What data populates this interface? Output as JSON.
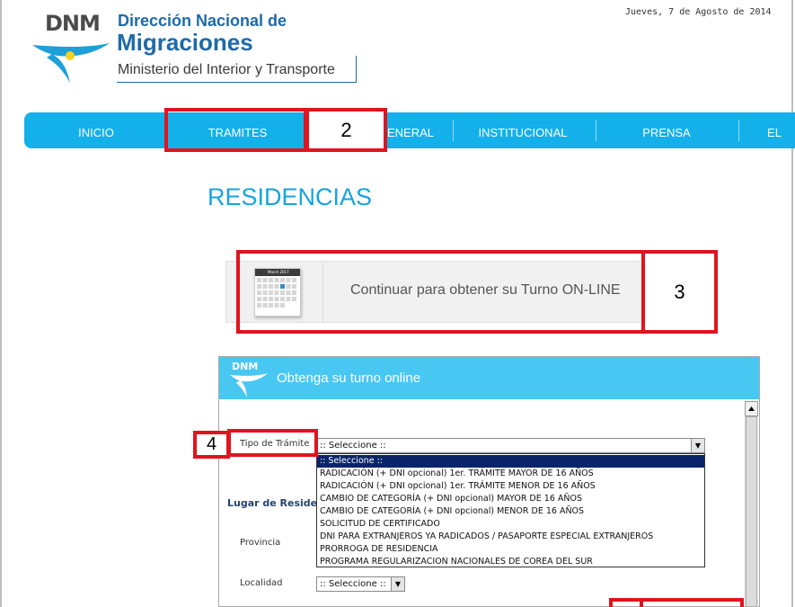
{
  "header": {
    "date": "Jueves, 7 de Agosto de 2014",
    "logo": {
      "acronym": "DNM",
      "line1": "Dirección Nacional de",
      "line2": "Migraciones",
      "line3": "Ministerio del Interior y Transporte"
    }
  },
  "nav": {
    "items": [
      {
        "label": "INICIO"
      },
      {
        "label": "TRAMITES"
      },
      {
        "label": "ENERAL"
      },
      {
        "label": "INSTITUCIONAL"
      },
      {
        "label": "PRENSA"
      },
      {
        "label": "EL"
      }
    ]
  },
  "annotations": {
    "step2": "2",
    "step3": "3",
    "step4": "4"
  },
  "page": {
    "title": "RESIDENCIAS"
  },
  "banner": {
    "calendar_caption": "March 2017",
    "text": "Continuar para obtener su Turno ON-LINE"
  },
  "form": {
    "header_logo": "DNM",
    "header_title": "Obtenga su turno online",
    "tipo_label": "Tipo de Trámite",
    "tipo_selected": ":: Seleccione ::",
    "tipo_options": [
      ":: Seleccione ::",
      "RADICACIÓN (+ DNI opcional) 1er. TRÁMITE MAYOR DE 16 AÑOS",
      "RADICACIÓN (+ DNI opcional) 1er. TRÁMITE MENOR DE 16 AÑOS",
      "CAMBIO DE CATEGORÍA (+ DNI opcional) MAYOR DE 16 AÑOS",
      "CAMBIO DE CATEGORÍA (+ DNI opcional) MENOR DE 16 AÑOS",
      "SOLICITUD DE CERTIFICADO",
      "DNI PARA EXTRANJEROS YA RADICADOS / PASAPORTE ESPECIAL EXTRANJEROS",
      "PRORROGA DE RESIDENCIA",
      "PROGRAMA REGULARIZACION NACIONALES DE COREA DEL SUR"
    ],
    "lugar_label": "Lugar de Residencia",
    "provincia_label": "Provincia",
    "localidad_label": "Localidad",
    "localidad_selected": ":: Seleccione ::"
  },
  "colors": {
    "nav_bg": "#14b0ea",
    "accent": "#16a4e0",
    "brand": "#1e6aa8",
    "annotation": "#e0141e",
    "form_header": "#49c7f3"
  }
}
